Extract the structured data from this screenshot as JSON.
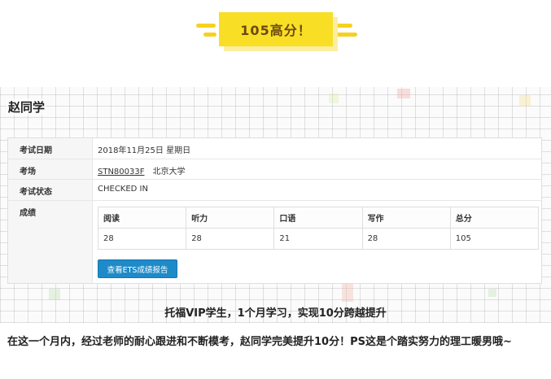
{
  "banner": {
    "text": "105高分！",
    "color": "#f9de26"
  },
  "student": {
    "name": "赵同学"
  },
  "exam": {
    "date_label": "考试日期",
    "date_value": "2018年11月25日 星期日",
    "center_label": "考场",
    "center_code": "STN80033F",
    "center_name": "北京大学",
    "status_label": "考试状态",
    "status_value": "CHECKED IN",
    "score_label": "成绩",
    "headers": [
      "阅读",
      "听力",
      "口语",
      "写作",
      "总分"
    ],
    "scores": [
      "28",
      "28",
      "21",
      "28",
      "105"
    ],
    "report_button": "查看ETS成绩报告",
    "button_color": "#1f8ac8"
  },
  "caption": "托福VIP学生，1个月学习，实现10分跨越提升",
  "paragraph": "在这一个月内，经过老师的耐心跟进和不断模考，赵同学完美提升10分！PS这是个踏实努力的理工暖男哦~"
}
